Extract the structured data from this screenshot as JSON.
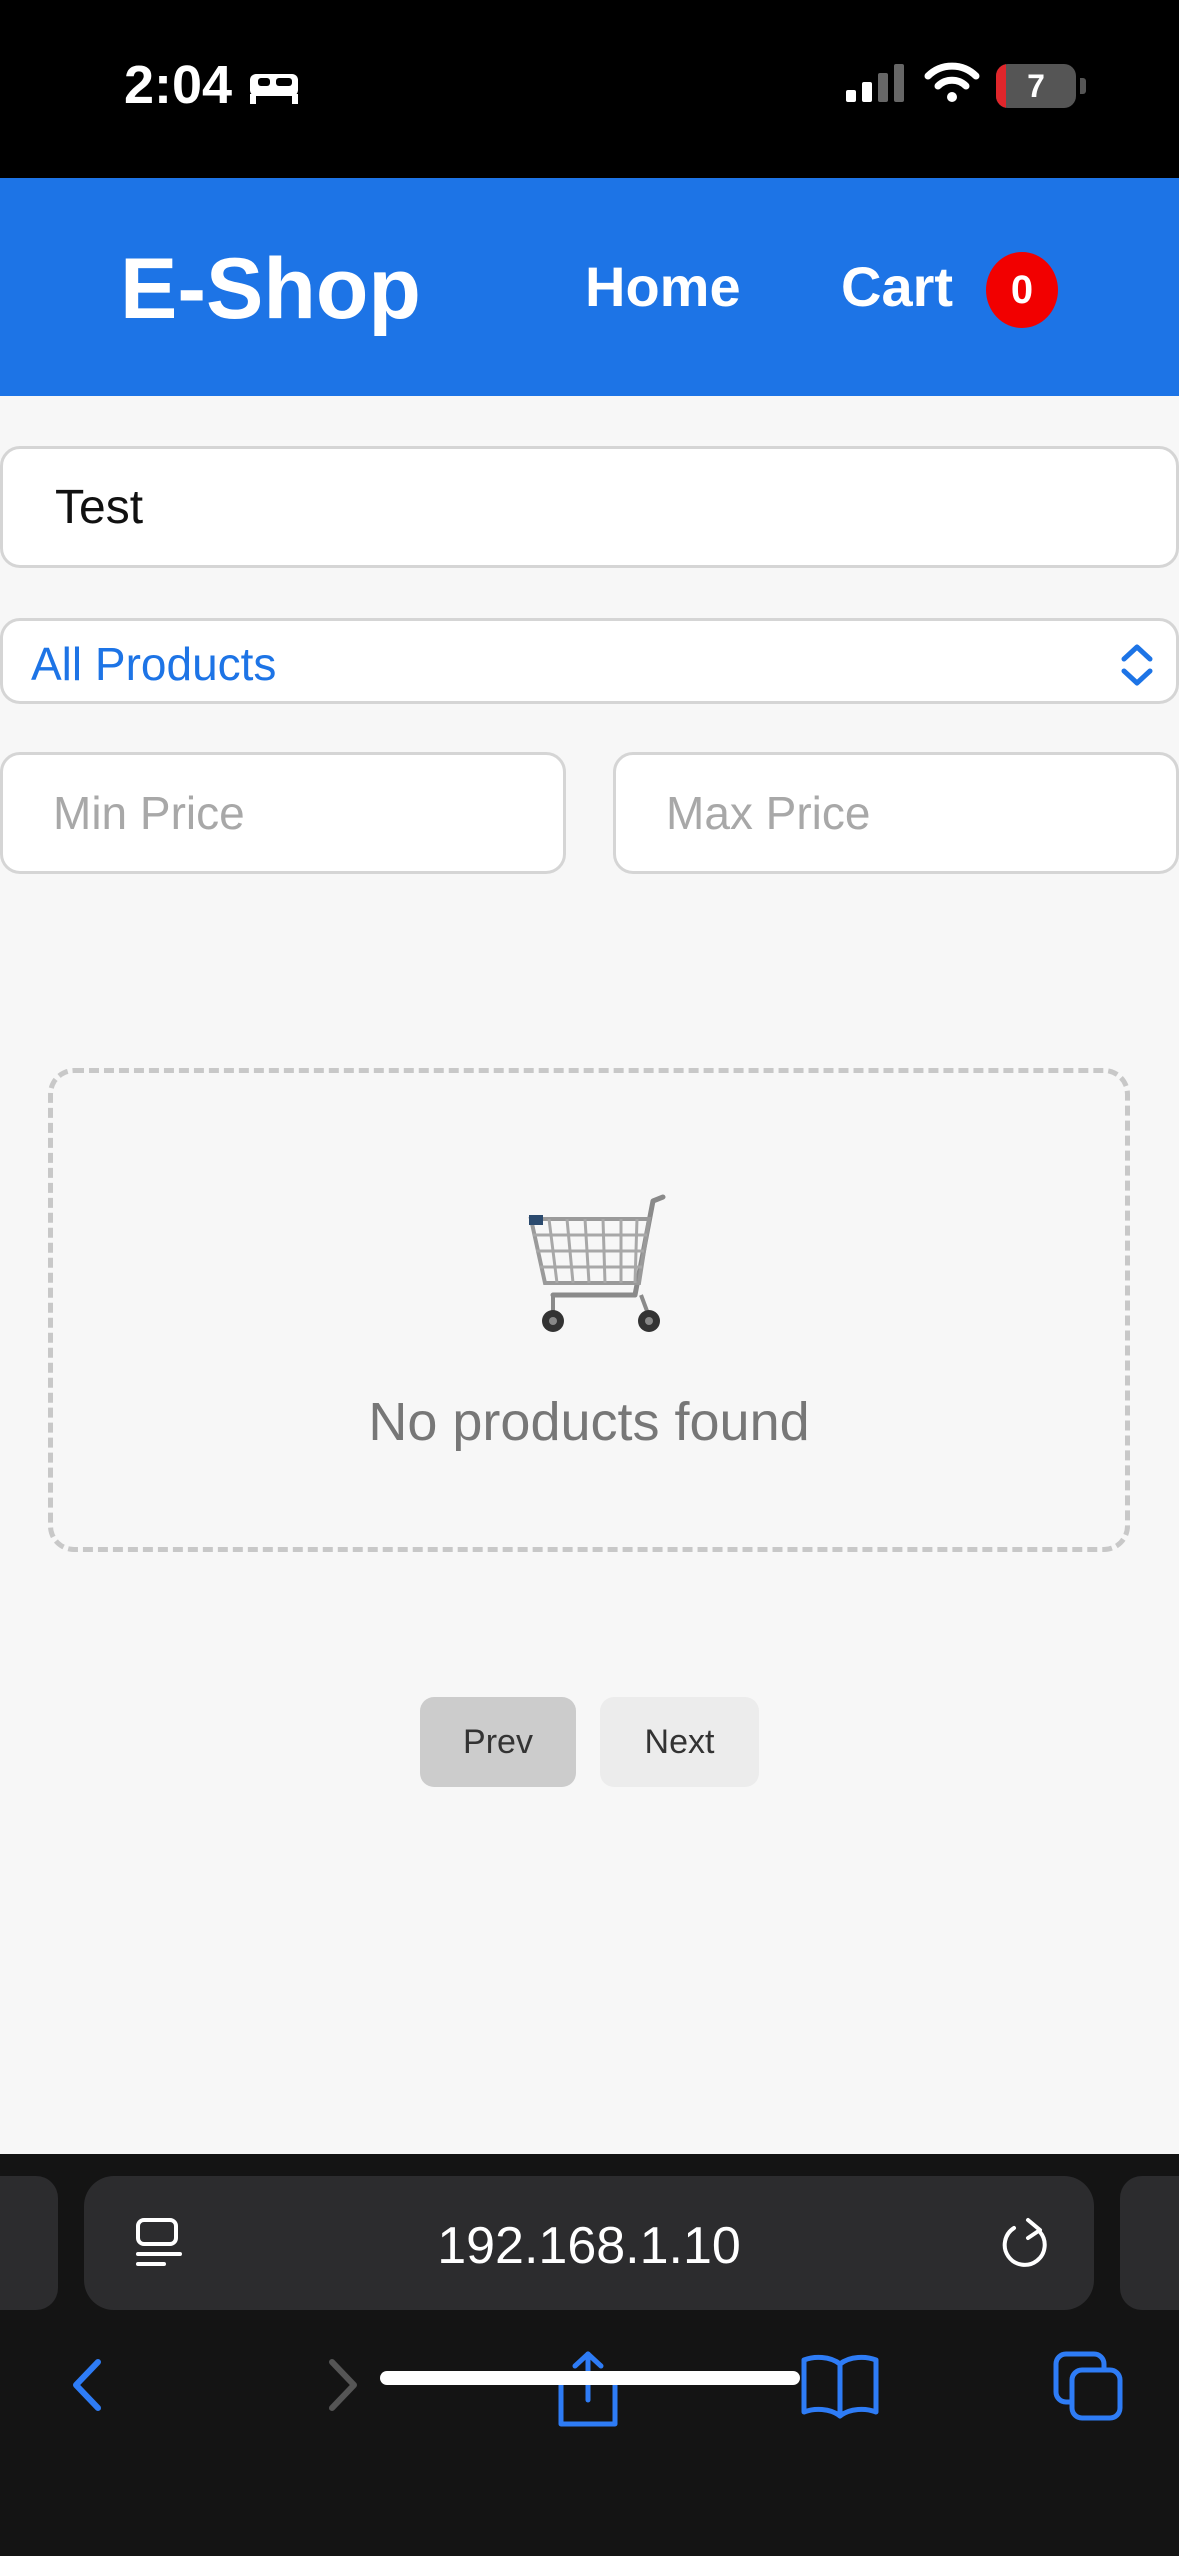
{
  "status_bar": {
    "time": "2:04",
    "battery": "7",
    "icons": [
      "bed-icon",
      "cellular-signal-icon",
      "wifi-icon",
      "battery-icon"
    ]
  },
  "header": {
    "brand": "E-Shop",
    "nav_home": "Home",
    "nav_cart": "Cart",
    "cart_count": "0",
    "brand_color": "#1d74e6",
    "badge_color": "#f20000"
  },
  "filters": {
    "search_value": "Test",
    "category_selected": "All Products",
    "min_price_placeholder": "Min Price",
    "max_price_placeholder": "Max Price"
  },
  "empty_state": {
    "icon": "shopping-cart-icon",
    "message": "No products found"
  },
  "pagination": {
    "prev_label": "Prev",
    "next_label": "Next"
  },
  "browser": {
    "url": "192.168.1.10",
    "toolbar_icons": [
      "back-icon",
      "forward-icon",
      "share-icon",
      "bookmarks-icon",
      "tabs-icon"
    ]
  }
}
